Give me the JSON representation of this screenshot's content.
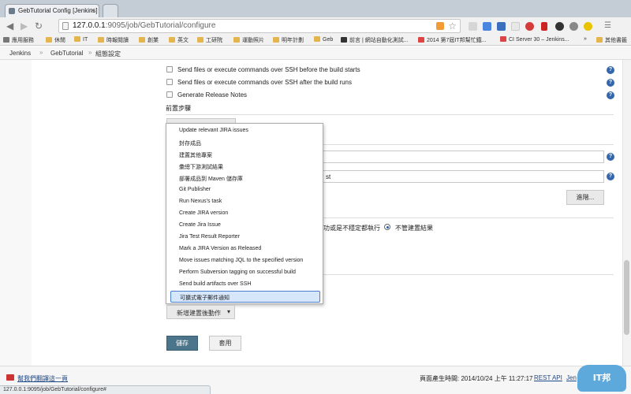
{
  "browser": {
    "tab_title": "GebTutorial Config [Jenkins]",
    "tab_close": "×",
    "url_host": "127.0.0.1",
    "url_path": ":9095/job/GebTutorial/configure",
    "status_url": "127.0.0.1:9095/job/GebTutorial/configure#",
    "icons": [
      "back-icon",
      "forward-icon",
      "reload-icon",
      "rss-icon",
      "star-icon",
      "gmail-icon",
      "translate-icon",
      "download-icon",
      "adblock-icon",
      "flag-icon",
      "settings-icon"
    ]
  },
  "bookmarks": {
    "apps": "應用服務",
    "items": [
      "休閒",
      "IT",
      "時報閱讀",
      "創業",
      "英文",
      "工研院",
      "運動照片",
      "明年計劃",
      "Geb",
      "前言 | 網站自動化測試...",
      "2014 第7屆IT邦幫忙鐵...",
      "CI Server 30 – Jenkins..."
    ],
    "more": "»",
    "other": "其他書籤"
  },
  "breadcrumb": {
    "jenkins": "Jenkins",
    "job": "GebTutorial",
    "page": "組態設定",
    "sep": "»"
  },
  "config": {
    "ssh_before": "Send files or execute commands over SSH before the build starts",
    "ssh_after": "Send files or execute commands over SSH after the build runs",
    "release_notes": "Generate Release Notes",
    "pre_steps_title": "前置步驟",
    "field1_value": "",
    "field2_value": "st",
    "advanced_button": "進階...",
    "build_result_partial": "功或是不穩定都執行",
    "build_result_always": "不管建置結果",
    "help": "?"
  },
  "dropdown": {
    "items": [
      "Update relevant JIRA issues",
      "封存成品",
      "建置其他專案",
      "彙總下游測試結果",
      "部署成品到 Maven 儲存庫",
      "Git Publisher",
      "Run Nexus's task",
      "Create JIRA version",
      "Create Jira Issue",
      "Jira Test Result Reporter",
      "Mark a JIRA Version as Released",
      "Move issues matching JQL to the specified version",
      "Perform Subversion tagging on successful build",
      "Send build artifacts over SSH",
      "可擴式電子郵件通知"
    ],
    "selected_index": 14
  },
  "post_build": {
    "add_button": "新增建置後動作",
    "arrow": "▾"
  },
  "actions": {
    "save": "儲存",
    "apply": "套用"
  },
  "footer": {
    "translate_link": "幫我們翻譯這一頁",
    "generated": "頁面產生時間: 2014/10/24 上午 11:27:17",
    "rest_api": "REST API",
    "jenkins_ver": "Jen",
    "logo_text": "IT邦"
  }
}
